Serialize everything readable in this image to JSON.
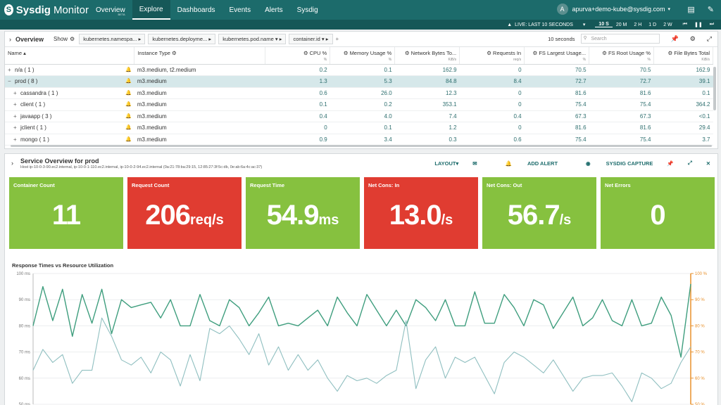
{
  "nav": {
    "logo_bold": "Sysdig",
    "logo_light": "Monitor",
    "items": [
      {
        "label": "Overview",
        "badge": "BETA"
      },
      {
        "label": "Explore"
      },
      {
        "label": "Dashboards"
      },
      {
        "label": "Events"
      },
      {
        "label": "Alerts"
      },
      {
        "label": "Sysdig"
      }
    ],
    "user_initial": "A",
    "user_email": "apurva+demo-kube@sysdig.com",
    "icon_names": [
      "docs-icon",
      "notification-icon"
    ]
  },
  "live": {
    "label": "LIVE: LAST 10 SECONDS",
    "ranges": [
      "10 S",
      "20 M",
      "2 H",
      "1 D",
      "2 W"
    ],
    "active_range": "10 S"
  },
  "table": {
    "title": "Overview",
    "show_label": "Show",
    "groupings": [
      "kubernetes.namespa...",
      "kubernetes.deployme...",
      "kubernetes.pod.name",
      "container.id"
    ],
    "add_label": "+",
    "refresh": "10 seconds",
    "search_placeholder": "Search",
    "columns": [
      {
        "label": "Name",
        "unit": ""
      },
      {
        "label": "Instance Type",
        "unit": ""
      },
      {
        "label": "CPU %",
        "unit": "%"
      },
      {
        "label": "Memory Usage %",
        "unit": "%"
      },
      {
        "label": "Network Bytes To...",
        "unit": "KiB/s"
      },
      {
        "label": "Requests In",
        "unit": "req/s"
      },
      {
        "label": "FS Largest Usage...",
        "unit": "%"
      },
      {
        "label": "FS Root Usage %",
        "unit": "%"
      },
      {
        "label": "File Bytes Total",
        "unit": "KiB/s"
      }
    ],
    "rows": [
      {
        "exp": "+",
        "name": "n/a ( 1 )",
        "itype": "m3.medium, t2.medium",
        "cpu": "0.2",
        "mem": "0.1",
        "net": "162.9",
        "req": "0",
        "fsl": "70.5",
        "fsr": "70.5",
        "fbt": "162.9",
        "selected": false,
        "indent": false
      },
      {
        "exp": "−",
        "name": "prod ( 8 )",
        "itype": "m3.medium",
        "cpu": "1.3",
        "mem": "5.3",
        "net": "84.8",
        "req": "8.4",
        "fsl": "72.7",
        "fsr": "72.7",
        "fbt": "39.1",
        "selected": true,
        "indent": false
      },
      {
        "exp": "+",
        "name": "cassandra ( 1 )",
        "itype": "m3.medium",
        "cpu": "0.6",
        "mem": "26.0",
        "net": "12.3",
        "req": "0",
        "fsl": "81.6",
        "fsr": "81.6",
        "fbt": "0.1",
        "selected": false,
        "indent": true
      },
      {
        "exp": "+",
        "name": "client ( 1 )",
        "itype": "m3.medium",
        "cpu": "0.1",
        "mem": "0.2",
        "net": "353.1",
        "req": "0",
        "fsl": "75.4",
        "fsr": "75.4",
        "fbt": "364.2",
        "selected": false,
        "indent": true
      },
      {
        "exp": "+",
        "name": "javaapp ( 3 )",
        "itype": "m3.medium",
        "cpu": "0.4",
        "mem": "4.0",
        "net": "7.4",
        "req": "0.4",
        "fsl": "67.3",
        "fsr": "67.3",
        "fbt": "<0.1",
        "selected": false,
        "indent": true
      },
      {
        "exp": "+",
        "name": "jclient ( 1 )",
        "itype": "m3.medium",
        "cpu": "0",
        "mem": "0.1",
        "net": "1.2",
        "req": "0",
        "fsl": "81.6",
        "fsr": "81.6",
        "fbt": "29.4",
        "selected": false,
        "indent": true
      },
      {
        "exp": "+",
        "name": "mongo ( 1 )",
        "itype": "m3.medium",
        "cpu": "0.9",
        "mem": "3.4",
        "net": "0.3",
        "req": "0.6",
        "fsl": "75.4",
        "fsr": "75.4",
        "fbt": "3.7",
        "selected": false,
        "indent": true
      }
    ]
  },
  "service": {
    "title": "Service Overview for prod",
    "hosts": "Host ip-10-0-3-90.ec2.internal, ip-10-0-1-110.ec2.internal, ip-10-0-2-94.ec2.internal (0a:21:78:ba:29:15, 12:85:27:3f:5c:db, 0e:ab:6a:4c:ac:37)",
    "actions": {
      "layout": "LAYOUT",
      "add_alert": "ADD ALERT",
      "capture": "SYSDIG CAPTURE"
    },
    "tiles": [
      {
        "label": "Container Count",
        "value": "11",
        "unit": "",
        "color": "green"
      },
      {
        "label": "Request Count",
        "value": "206",
        "unit": "req/s",
        "color": "red"
      },
      {
        "label": "Request Time",
        "value": "54.9",
        "unit": "ms",
        "color": "green"
      },
      {
        "label": "Net Cons: In",
        "value": "13.0",
        "unit": "/s",
        "color": "red"
      },
      {
        "label": "Net Cons: Out",
        "value": "56.7",
        "unit": "/s",
        "color": "green"
      },
      {
        "label": "Net Errors",
        "value": "0",
        "unit": "",
        "color": "green"
      }
    ]
  },
  "colors": {
    "green_tile": "#86c13f",
    "red_tile": "#e03c31",
    "nav": "#1c6b6b",
    "series_dark": "#3f9e7e",
    "series_light": "#8fbfc0",
    "right_axis": "#e8912c"
  },
  "chart_data": {
    "type": "line",
    "title": "Response Times vs Resource Utilization",
    "yleft_ticks": [
      "100 ms",
      "90 ms",
      "80 ms",
      "70 ms",
      "60 ms",
      "50 ms"
    ],
    "yright_ticks": [
      "100 %",
      "90 %",
      "80 %",
      "70 %",
      "60 %",
      "50 %"
    ],
    "ylim": [
      50,
      100
    ],
    "series": [
      {
        "values": [
          80,
          95,
          82,
          94,
          76,
          92,
          81,
          94,
          77,
          90,
          87,
          88,
          89,
          83,
          90,
          80,
          80,
          92,
          82,
          80,
          90,
          87,
          80,
          85,
          91,
          80,
          81,
          80,
          83,
          86,
          80,
          91,
          85,
          80,
          92,
          86,
          80,
          86,
          80,
          90,
          87,
          82,
          90,
          80,
          80,
          93,
          81,
          81,
          92,
          87,
          80,
          90,
          88,
          79,
          85,
          91,
          80,
          83,
          90,
          82,
          80,
          90,
          80,
          81,
          91,
          84,
          68,
          96
        ]
      },
      {
        "values": [
          63,
          71,
          66,
          69,
          58,
          63,
          63,
          83,
          76,
          67,
          65,
          68,
          62,
          70,
          67,
          57,
          69,
          59,
          79,
          77,
          80,
          75,
          69,
          77,
          65,
          72,
          63,
          69,
          63,
          67,
          60,
          55,
          61,
          59,
          60,
          58,
          61,
          63,
          82,
          56,
          67,
          72,
          60,
          68,
          66,
          68,
          61,
          54,
          66,
          70,
          68,
          65,
          62,
          67,
          61,
          55,
          60,
          61,
          61,
          62,
          57,
          51,
          62,
          60,
          56,
          58,
          66,
          72
        ]
      }
    ]
  }
}
